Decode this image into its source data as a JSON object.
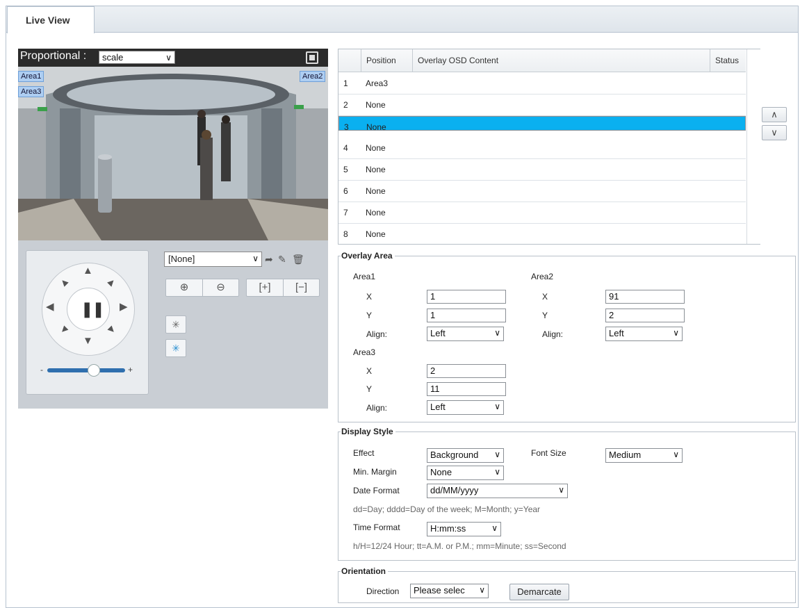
{
  "tabs": {
    "active": "Live View"
  },
  "video": {
    "proportional_label": "Proportional :",
    "scale_value": "scale",
    "overlays": [
      "Area1",
      "Area2",
      "Area3"
    ]
  },
  "ptz": {
    "preset_value": "[None]",
    "slider_minus": "-",
    "slider_plus": "+",
    "pause_glyph": "❚❚"
  },
  "osd_table": {
    "headers": [
      "Position",
      "Overlay OSD Content",
      "Status"
    ],
    "rows": [
      {
        "pos": "1",
        "content": "Area3"
      },
      {
        "pos": "2",
        "content": "None"
      },
      {
        "pos": "3",
        "content": "None",
        "selected": true
      },
      {
        "pos": "4",
        "content": "None"
      },
      {
        "pos": "5",
        "content": "None"
      },
      {
        "pos": "6",
        "content": "None"
      },
      {
        "pos": "7",
        "content": "None"
      },
      {
        "pos": "8",
        "content": "None"
      }
    ],
    "selected_color": "#0ab0f0"
  },
  "overlay_area": {
    "legend": "Overlay Area",
    "area1": {
      "title": "Area1",
      "x_label": "X",
      "y_label": "Y",
      "align_label": "Align:",
      "x": "1",
      "y": "1",
      "align": "Left"
    },
    "area2": {
      "title": "Area2",
      "x_label": "X",
      "y_label": "Y",
      "align_label": "Align:",
      "x": "91",
      "y": "2",
      "align": "Left"
    },
    "area3": {
      "title": "Area3",
      "x_label": "X",
      "y_label": "Y",
      "align_label": "Align:",
      "x": "2",
      "y": "11",
      "align": "Left"
    }
  },
  "display_style": {
    "legend": "Display Style",
    "effect_label": "Effect",
    "effect": "Background",
    "font_size_label": "Font Size",
    "font_size": "Medium",
    "min_margin_label": "Min. Margin",
    "min_margin": "None",
    "date_format_label": "Date Format",
    "date_format": "dd/MM/yyyy",
    "date_hint": "dd=Day; dddd=Day of the week; M=Month; y=Year",
    "time_format_label": "Time Format",
    "time_format": "H:mm:ss",
    "time_hint": "h/H=12/24 Hour; tt=A.M. or P.M.; mm=Minute; ss=Second"
  },
  "orientation": {
    "legend": "Orientation",
    "direction_label": "Direction",
    "direction": "Please selec",
    "demarcate_label": "Demarcate"
  }
}
